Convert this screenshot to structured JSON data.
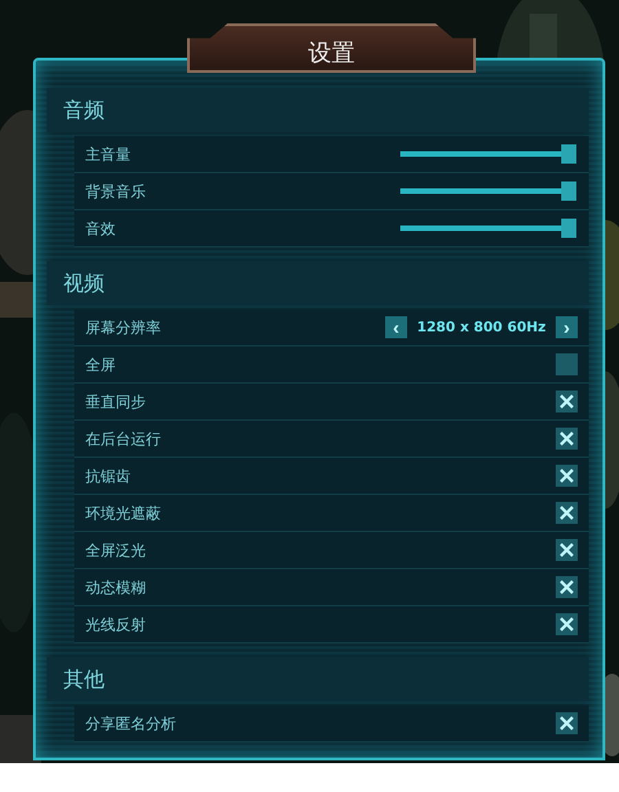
{
  "window": {
    "title": "设置"
  },
  "sections": [
    {
      "title": "音频",
      "items": [
        {
          "kind": "slider",
          "label": "主音量",
          "level": 1
        },
        {
          "kind": "slider",
          "label": "背景音乐",
          "level": 1
        },
        {
          "kind": "slider",
          "label": "音效",
          "level": 1
        }
      ]
    },
    {
      "title": "视频",
      "items": [
        {
          "kind": "selector",
          "label": "屏幕分辨率",
          "value": "1280 x 800 60Hz",
          "prev": "‹",
          "next": "›"
        },
        {
          "kind": "checkbox",
          "label": "全屏",
          "checked": false
        },
        {
          "kind": "checkbox",
          "label": "垂直同步",
          "checked": true
        },
        {
          "kind": "checkbox",
          "label": "在后台运行",
          "checked": true
        },
        {
          "kind": "checkbox",
          "label": "抗锯齿",
          "checked": true
        },
        {
          "kind": "checkbox",
          "label": "环境光遮蔽",
          "checked": true
        },
        {
          "kind": "checkbox",
          "label": "全屏泛光",
          "checked": true
        },
        {
          "kind": "checkbox",
          "label": "动态模糊",
          "checked": true
        },
        {
          "kind": "checkbox",
          "label": "光线反射",
          "checked": true
        }
      ]
    },
    {
      "title": "其他",
      "items": [
        {
          "kind": "checkbox",
          "label": "分享匿名分析",
          "checked": true
        }
      ]
    }
  ]
}
